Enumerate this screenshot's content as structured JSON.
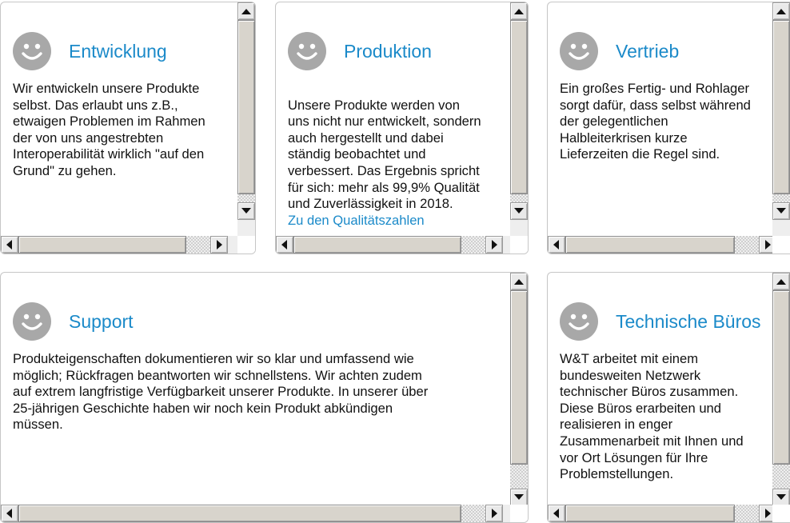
{
  "colors": {
    "accent": "#1b8ac9",
    "text": "#111111",
    "icon": "#a8a8a8"
  },
  "cards": [
    {
      "icon": "smiley-icon",
      "title": "Entwicklung",
      "text": "Wir entwickeln unsere Produkte\nselbst. Das erlaubt uns z.B.,\netwaigen Problemen im Rahmen\nder von uns angestrebten\nInteroperabilität wirklich \"auf den\nGrund\" zu gehen.",
      "link": ""
    },
    {
      "icon": "smiley-icon",
      "title": "Produktion",
      "text": "Unsere Produkte werden von\nuns nicht nur entwickelt, sondern\nauch hergestellt und dabei\nständig beobachtet und\nverbessert. Das Ergebnis spricht\nfür sich: mehr als 99,9% Qualität\nund Zuverlässigkeit in 2018.",
      "link": "Zu den Qualitätszahlen"
    },
    {
      "icon": "smiley-icon",
      "title": "Vertrieb",
      "text": "Ein großes Fertig- und Rohlager\nsorgt dafür, dass selbst während\nder gelegentlichen\nHalbleiterkrisen kurze\nLieferzeiten die Regel sind.",
      "link": ""
    },
    {
      "icon": "smiley-icon",
      "title": "Support",
      "text": "Produkteigenschaften dokumentieren wir so klar und umfassend wie\nmöglich; Rückfragen beantworten wir schnellstens. Wir achten zudem\nauf extrem langfristige Verfügbarkeit unserer Produkte. In unserer über\n25-jährigen Geschichte haben wir noch kein Produkt abkündigen\nmüssen.",
      "link": ""
    },
    {
      "icon": "smiley-icon",
      "title": "Technische Büros",
      "text": "W&T arbeitet mit einem\nbundesweiten Netzwerk\ntechnischer Büros zusammen.\nDiese Büros erarbeiten und\nrealisieren in enger\nZusammenarbeit mit Ihnen und\nvor Ort Lösungen für Ihre\nProblemstellungen.",
      "link": ""
    }
  ]
}
